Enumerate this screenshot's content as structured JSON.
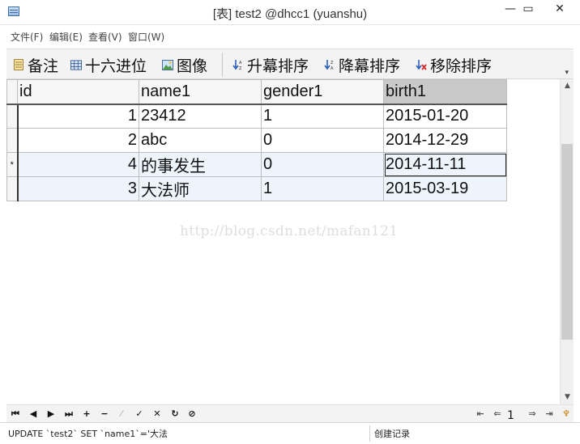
{
  "window": {
    "title": "[表] test2 @dhcc1 (yuanshu)",
    "minimize_glyph": "▭",
    "close_glyph": "✕"
  },
  "menu": [
    "文件(F)",
    "编辑(E)",
    "查看(V)",
    "窗口(W)"
  ],
  "toolbar": {
    "memo": "备注",
    "hex": "十六进位",
    "image": "图像",
    "sort_asc": "升幕排序",
    "sort_desc": "降幕排序",
    "remove_sort": "移除排序"
  },
  "table": {
    "columns": [
      "id",
      "name1",
      "gender1",
      "birth1"
    ],
    "selected_column": "birth1",
    "rows": [
      {
        "indicator": "",
        "id": "1",
        "name1": "23412",
        "gender1": "1",
        "birth1": "2015-01-20"
      },
      {
        "indicator": "",
        "id": "2",
        "name1": "abc",
        "gender1": "0",
        "birth1": "2014-12-29"
      },
      {
        "indicator": "*",
        "id": "4",
        "name1": "的事发生",
        "gender1": "0",
        "birth1": "2014-11-11"
      },
      {
        "indicator": "",
        "id": "3",
        "name1": "大法师",
        "gender1": "1",
        "birth1": "2015-03-19"
      }
    ]
  },
  "watermark": "http://blog.csdn.net/mafan121",
  "navigation": {
    "page": "1"
  },
  "status": {
    "sql": "UPDATE `test2` SET `name1`='大法",
    "mode": "创建记录"
  },
  "icons": {
    "memo": "memo-icon",
    "hex": "hex-grid-icon",
    "image": "image-icon",
    "sort_asc": "sort-ascending-icon",
    "sort_desc": "sort-descending-icon",
    "remove_sort": "remove-sort-icon"
  }
}
